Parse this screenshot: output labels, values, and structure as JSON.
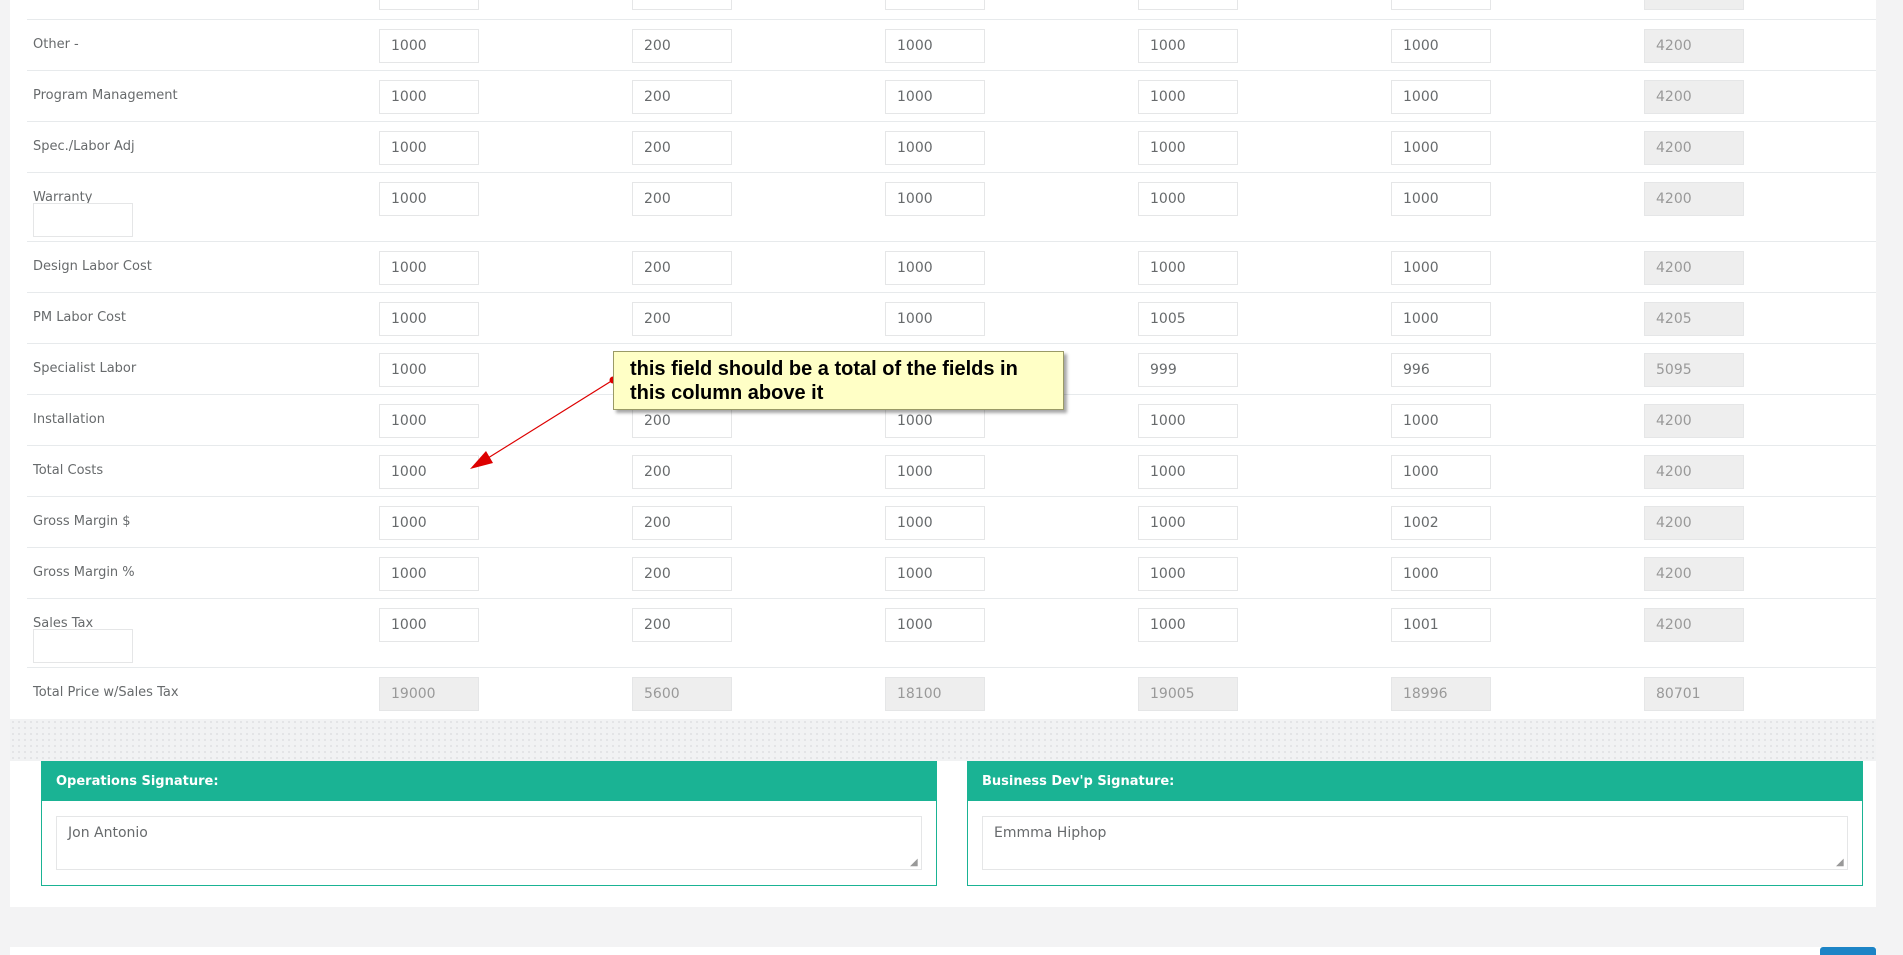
{
  "colors": {
    "accent": "#1ab394",
    "primary_button": "#1c84c6",
    "callout_fill": "#ffffc6",
    "annotation_arrow": "#dd0000"
  },
  "cost_table": {
    "rows": [
      {
        "label": "Other -",
        "values": [
          "1000",
          "200",
          "1000",
          "1000",
          "1000",
          "4200"
        ]
      },
      {
        "label": "Program Management",
        "values": [
          "1000",
          "200",
          "1000",
          "1000",
          "1000",
          "4200"
        ]
      },
      {
        "label": "Spec./Labor Adj",
        "values": [
          "1000",
          "200",
          "1000",
          "1000",
          "1000",
          "4200"
        ]
      },
      {
        "label": "Warranty",
        "values": [
          "1000",
          "200",
          "1000",
          "1000",
          "1000",
          "4200"
        ],
        "sub_input": ""
      },
      {
        "label": "Design Labor Cost",
        "values": [
          "1000",
          "200",
          "1000",
          "1000",
          "1000",
          "4200"
        ]
      },
      {
        "label": "PM Labor Cost",
        "values": [
          "1000",
          "200",
          "1000",
          "1005",
          "1000",
          "4205"
        ]
      },
      {
        "label": "Specialist Labor",
        "values": [
          "1000",
          "",
          "",
          "999",
          "996",
          "5095"
        ]
      },
      {
        "label": "Installation",
        "values": [
          "1000",
          "200",
          "1000",
          "1000",
          "1000",
          "4200"
        ]
      },
      {
        "label": "Total Costs",
        "values": [
          "1000",
          "200",
          "1000",
          "1000",
          "1000",
          "4200"
        ]
      },
      {
        "label": "Gross Margin $",
        "values": [
          "1000",
          "200",
          "1000",
          "1000",
          "1002",
          "4200"
        ]
      },
      {
        "label": "Gross Margin %",
        "values": [
          "1000",
          "200",
          "1000",
          "1000",
          "1000",
          "4200"
        ]
      },
      {
        "label": "Sales Tax",
        "values": [
          "1000",
          "200",
          "1000",
          "1000",
          "1001",
          "4200"
        ],
        "sub_input": ""
      },
      {
        "label": "Total Price w/Sales Tax",
        "values": [
          "19000",
          "5600",
          "18100",
          "19005",
          "18996",
          "80701"
        ]
      }
    ]
  },
  "signatures": {
    "operations": {
      "label": "Operations Signature:",
      "value": "Jon Antonio"
    },
    "business_dev": {
      "label": "Business Dev'p Signature:",
      "value": "Emmma Hiphop"
    }
  },
  "annotation": {
    "text": "this field should be a total of the fields in this column above it"
  }
}
